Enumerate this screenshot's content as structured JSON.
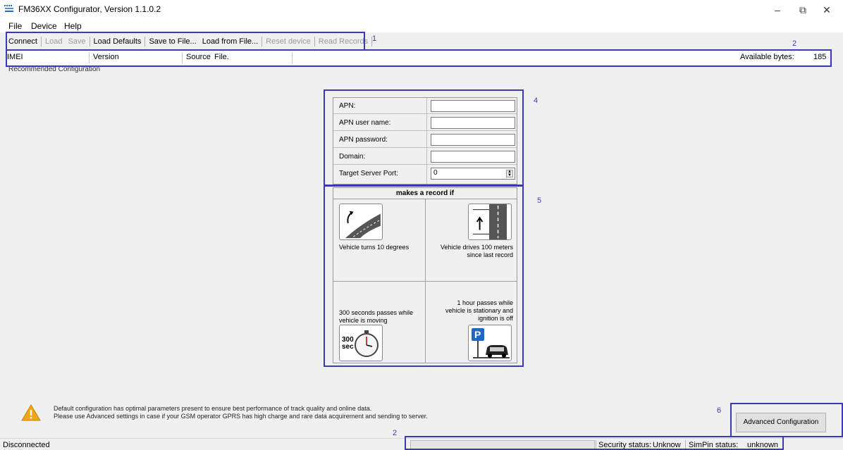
{
  "window": {
    "title": "FM36XX Configurator, Version 1.1.0.2",
    "min_glyph": "–",
    "max_glyph": "⧉",
    "close_glyph": "✕"
  },
  "menu": {
    "file": "File",
    "device": "Device",
    "help": "Help"
  },
  "toolbar": {
    "connect": "Connect",
    "load": "Load",
    "save": "Save",
    "load_defaults": "Load Defaults",
    "save_to_file": "Save to File...",
    "load_from_file": "Load from File...",
    "reset_device": "Reset device",
    "read_records": "Read Records"
  },
  "infobar": {
    "imei_label": "IMEI",
    "version_label": "Version",
    "source_label": "Source",
    "source_value": "File.",
    "available_bytes_label": "Available bytes:",
    "available_bytes_value": "185"
  },
  "recommended_label": "Recommended Configuration",
  "gprs_form": {
    "apn_label": "APN:",
    "apn_value": "",
    "apn_user_label": "APN user name:",
    "apn_user_value": "",
    "apn_password_label": "APN password:",
    "apn_password_value": "",
    "domain_label": "Domain:",
    "domain_value": "",
    "port_label": "Target Server Port:",
    "port_value": "0"
  },
  "record_conditions": {
    "header": "makes a record if",
    "turn_line1": "Vehicle turns 10 degrees",
    "distance_line1": "Vehicle drives 100 meters",
    "distance_line2": "since last record",
    "time_line1": "300 seconds passes while",
    "time_line2": "vehicle is moving",
    "stopwatch_label": "300",
    "stopwatch_unit": "sec",
    "stationary_line1": "1 hour passes while",
    "stationary_line2": "vehicle is stationary and",
    "stationary_line3": "ignition is off",
    "parking_letter": "P"
  },
  "warning": {
    "line1": "Default configuration has optimal parameters present to ensure best performance of track quality and online data.",
    "line2": "Please use Advanced settings in case if your GSM operator GPRS has high charge and rare data acquirement and sending to server."
  },
  "advanced_button": "Advanced Configuration",
  "statusbar": {
    "connection": "Disconnected",
    "security_label": "Security status:",
    "security_value": "Unknow",
    "simpin_label": "SimPin status:",
    "simpin_value": "unknown"
  },
  "annotations": {
    "callout_1": "1",
    "callout_2_top": "2",
    "callout_2_bottom": "2",
    "callout_4": "4",
    "callout_5": "5",
    "callout_6": "6"
  },
  "colors": {
    "callout": "#3a3ab8",
    "window_bg": "#f0f0f0",
    "disabled_text": "#9a9a9a",
    "warning": "#f2a516"
  }
}
